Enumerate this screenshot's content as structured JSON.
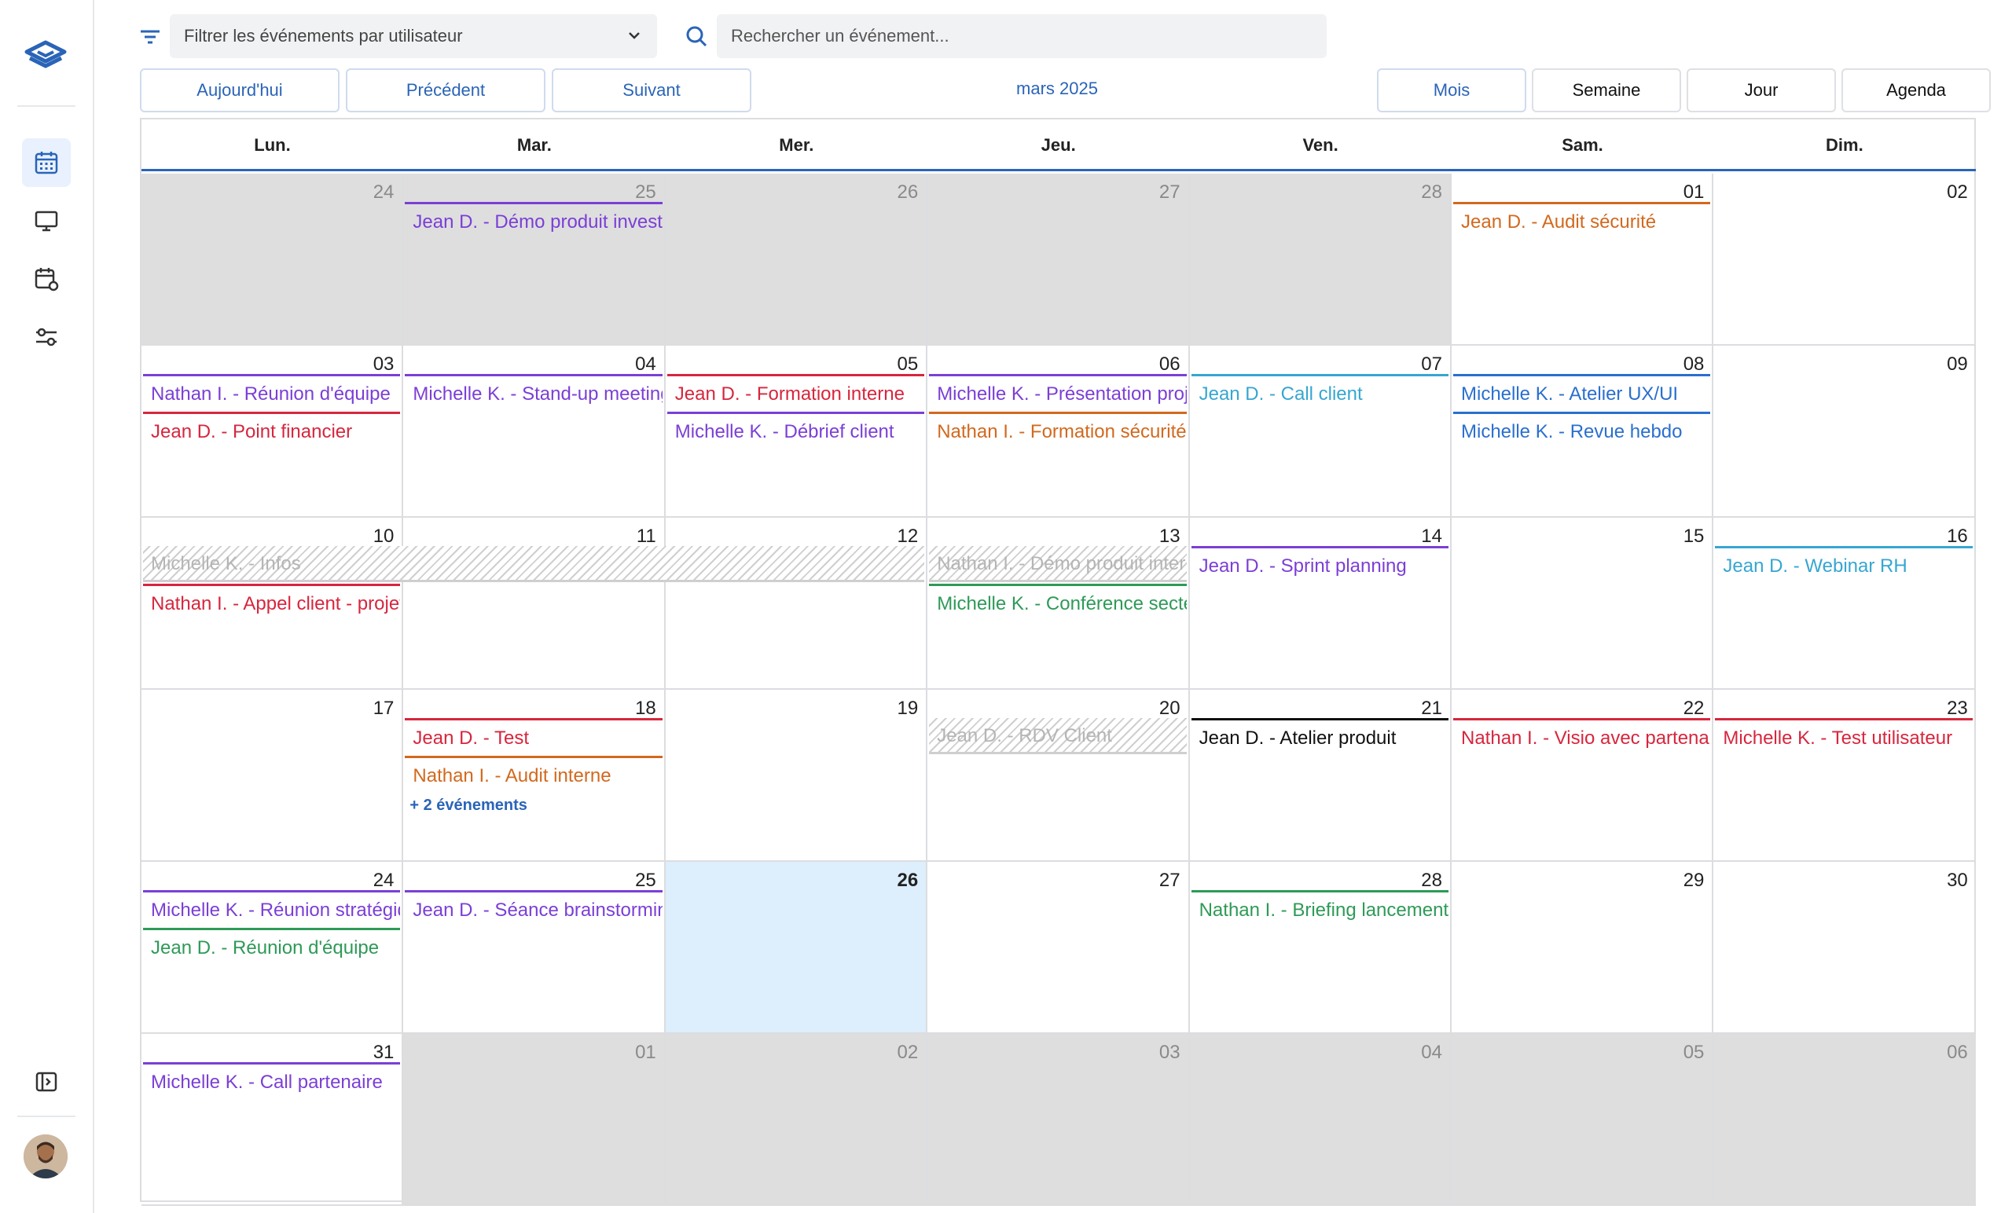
{
  "colors": {
    "accent": "#2a64b8",
    "purple": "#7b3fd6",
    "red": "#d7263d",
    "orange": "#d2691e",
    "cyan": "#36a6d1",
    "blue": "#2a6fcf",
    "green": "#2e9a57",
    "black": "#111111",
    "grey": "#b5b5b5"
  },
  "sidebar": {
    "logo_icon": "stacked-layers-logo",
    "items": [
      {
        "icon": "calendar-icon",
        "active": true
      },
      {
        "icon": "monitor-icon",
        "active": false
      },
      {
        "icon": "calendar-settings-icon",
        "active": false
      },
      {
        "icon": "sliders-icon",
        "active": false
      }
    ],
    "collapse_icon": "sidebar-toggle-icon",
    "avatar_icon": "user-avatar"
  },
  "toolbar": {
    "filter_placeholder": "Filtrer les événements par utilisateur",
    "search_placeholder": "Rechercher un événement...",
    "today_label": "Aujourd'hui",
    "prev_label": "Précédent",
    "next_label": "Suivant",
    "period": "mars 2025",
    "views": [
      "Mois",
      "Semaine",
      "Jour",
      "Agenda"
    ],
    "active_view": "Mois"
  },
  "calendar": {
    "weekdays": [
      "Lun.",
      "Mar.",
      "Mer.",
      "Jeu.",
      "Ven.",
      "Sam.",
      "Dim."
    ],
    "weeks": [
      [
        "24",
        "25",
        "26",
        "27",
        "28",
        "01",
        "02"
      ],
      [
        "03",
        "04",
        "05",
        "06",
        "07",
        "08",
        "09"
      ],
      [
        "10",
        "11",
        "12",
        "13",
        "14",
        "15",
        "16"
      ],
      [
        "17",
        "18",
        "19",
        "20",
        "21",
        "22",
        "23"
      ],
      [
        "24",
        "25",
        "26",
        "27",
        "28",
        "29",
        "30"
      ],
      [
        "31",
        "01",
        "02",
        "03",
        "04",
        "05",
        "06"
      ]
    ],
    "outside_month": [
      [
        0,
        0
      ],
      [
        0,
        1
      ],
      [
        0,
        2
      ],
      [
        0,
        3
      ],
      [
        0,
        4
      ],
      [
        5,
        1
      ],
      [
        5,
        2
      ],
      [
        5,
        3
      ],
      [
        5,
        4
      ],
      [
        5,
        5
      ],
      [
        5,
        6
      ]
    ],
    "today": [
      4,
      2
    ],
    "events": [
      {
        "week": 0,
        "day": 1,
        "span": 1,
        "slot": 0,
        "text": "Jean D. -  Démo produit investisseurs",
        "color": "purple"
      },
      {
        "week": 0,
        "day": 5,
        "span": 1,
        "slot": 0,
        "text": "Jean D. -  Audit sécurité",
        "color": "orange"
      },
      {
        "week": 1,
        "day": 0,
        "span": 1,
        "slot": 0,
        "text": "Nathan I. -  Réunion d'équipe",
        "color": "purple"
      },
      {
        "week": 1,
        "day": 0,
        "span": 1,
        "slot": 1,
        "text": "Jean D. -  Point financier",
        "color": "red"
      },
      {
        "week": 1,
        "day": 1,
        "span": 1,
        "slot": 0,
        "text": "Michelle K. -  Stand-up meeting",
        "color": "purple"
      },
      {
        "week": 1,
        "day": 2,
        "span": 1,
        "slot": 0,
        "text": "Jean D. -  Formation interne",
        "color": "red"
      },
      {
        "week": 1,
        "day": 2,
        "span": 1,
        "slot": 1,
        "text": "Michelle K. -  Débrief client",
        "color": "purple"
      },
      {
        "week": 1,
        "day": 3,
        "span": 1,
        "slot": 0,
        "text": "Michelle K. -  Présentation projet",
        "color": "purple"
      },
      {
        "week": 1,
        "day": 3,
        "span": 1,
        "slot": 1,
        "text": "Nathan I. -  Formation sécurité",
        "color": "orange"
      },
      {
        "week": 1,
        "day": 4,
        "span": 1,
        "slot": 0,
        "text": "Jean D. -  Call client",
        "color": "cyan"
      },
      {
        "week": 1,
        "day": 5,
        "span": 1,
        "slot": 0,
        "text": "Michelle K. -  Atelier UX/UI",
        "color": "blue"
      },
      {
        "week": 1,
        "day": 5,
        "span": 1,
        "slot": 1,
        "text": "Michelle K. -  Revue hebdo",
        "color": "blue"
      },
      {
        "week": 2,
        "day": 0,
        "span": 3,
        "slot": 0,
        "text": "Michelle K. -  Infos",
        "color": "grey",
        "hatched": true
      },
      {
        "week": 2,
        "day": 0,
        "span": 1,
        "slot": 1,
        "text": "Nathan I. -  Appel client - projet",
        "color": "red"
      },
      {
        "week": 2,
        "day": 3,
        "span": 1,
        "slot": 0,
        "text": "Nathan I. -  Démo produit interne",
        "color": "grey",
        "hatched": true
      },
      {
        "week": 2,
        "day": 3,
        "span": 1,
        "slot": 1,
        "text": "Michelle K. -  Conférence secteur",
        "color": "green"
      },
      {
        "week": 2,
        "day": 4,
        "span": 1,
        "slot": 0,
        "text": "Jean D. -  Sprint planning",
        "color": "purple"
      },
      {
        "week": 2,
        "day": 6,
        "span": 1,
        "slot": 0,
        "text": "Jean D. -  Webinar RH",
        "color": "cyan"
      },
      {
        "week": 3,
        "day": 1,
        "span": 1,
        "slot": 0,
        "text": "Jean D. -  Test",
        "color": "red"
      },
      {
        "week": 3,
        "day": 1,
        "span": 1,
        "slot": 1,
        "text": "Nathan I. -  Audit interne",
        "color": "orange"
      },
      {
        "week": 3,
        "day": 3,
        "span": 1,
        "slot": 0,
        "text": "Jean D. -  RDV Client",
        "color": "grey",
        "hatched": true
      },
      {
        "week": 3,
        "day": 4,
        "span": 1,
        "slot": 0,
        "text": "Jean D. -  Atelier produit",
        "color": "black"
      },
      {
        "week": 3,
        "day": 5,
        "span": 1,
        "slot": 0,
        "text": "Nathan I. -  Visio avec partenaire",
        "color": "red"
      },
      {
        "week": 3,
        "day": 6,
        "span": 1,
        "slot": 0,
        "text": "Michelle K. -  Test utilisateur",
        "color": "red"
      },
      {
        "week": 4,
        "day": 0,
        "span": 1,
        "slot": 0,
        "text": "Michelle K. -  Réunion stratégique",
        "color": "purple"
      },
      {
        "week": 4,
        "day": 0,
        "span": 1,
        "slot": 1,
        "text": "Jean D. -  Réunion d'équipe",
        "color": "green"
      },
      {
        "week": 4,
        "day": 1,
        "span": 1,
        "slot": 0,
        "text": "Jean D. -  Séance brainstorming",
        "color": "purple"
      },
      {
        "week": 4,
        "day": 4,
        "span": 1,
        "slot": 0,
        "text": "Nathan I. -  Briefing lancement",
        "color": "green"
      },
      {
        "week": 5,
        "day": 0,
        "span": 1,
        "slot": 0,
        "text": "Michelle K. -  Call partenaire",
        "color": "purple"
      }
    ],
    "more_links": [
      {
        "week": 3,
        "day": 1,
        "text": "+ 2 événements"
      }
    ]
  }
}
